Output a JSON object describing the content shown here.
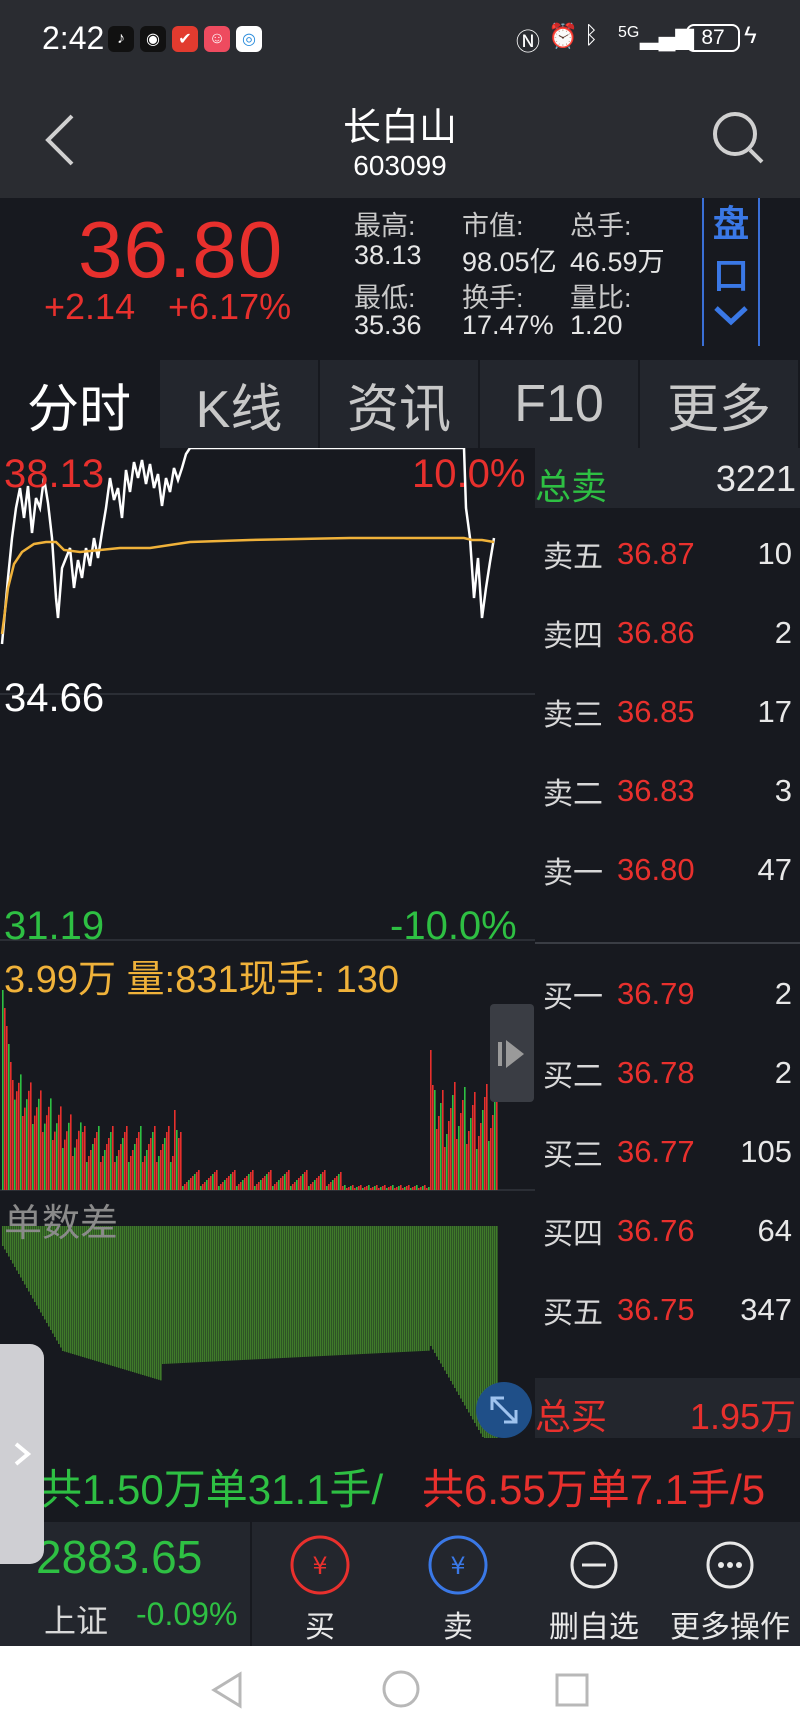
{
  "status_bar": {
    "time": "2:42",
    "battery": "87",
    "network": "5G"
  },
  "header": {
    "title": "长白山",
    "code": "603099"
  },
  "quote": {
    "price": "36.80",
    "change": "+2.14",
    "change_pct": "+6.17%",
    "labels": {
      "high": "最高:",
      "market_cap": "市值:",
      "total_volume": "总手:",
      "low": "最低:",
      "turnover": "换手:",
      "volume_ratio": "量比:"
    },
    "values": {
      "high": "38.13",
      "market_cap": "98.05亿",
      "total_volume": "46.59万",
      "low": "35.36",
      "turnover": "17.47%",
      "volume_ratio": "1.20"
    },
    "pankou_label": [
      "盘",
      "口"
    ]
  },
  "tabs": [
    "分时",
    "K线",
    "资讯",
    "F10",
    "更多"
  ],
  "chart": {
    "price_top": "38.13",
    "pct_top": "10.0%",
    "price_mid": "34.66",
    "price_bottom": "31.19",
    "pct_bottom": "-10.0%",
    "volume_info": "3.99万 量:831现手: 130",
    "indicator_label": "单数差"
  },
  "order_book": {
    "total_sell_label": "总卖",
    "total_sell": "3221",
    "asks": [
      {
        "label": "卖五",
        "price": "36.87",
        "vol": "10"
      },
      {
        "label": "卖四",
        "price": "36.86",
        "vol": "2"
      },
      {
        "label": "卖三",
        "price": "36.85",
        "vol": "17"
      },
      {
        "label": "卖二",
        "price": "36.83",
        "vol": "3"
      },
      {
        "label": "卖一",
        "price": "36.80",
        "vol": "47"
      }
    ],
    "bids": [
      {
        "label": "买一",
        "price": "36.79",
        "vol": "2"
      },
      {
        "label": "买二",
        "price": "36.78",
        "vol": "2"
      },
      {
        "label": "买三",
        "price": "36.77",
        "vol": "105"
      },
      {
        "label": "买四",
        "price": "36.76",
        "vol": "64"
      },
      {
        "label": "买五",
        "price": "36.75",
        "vol": "347"
      }
    ],
    "total_buy_label": "总买",
    "total_buy": "1.95万"
  },
  "ticker": {
    "part1": "共1.50万单31.1手/",
    "part2": "共6.55万单7.1手/5"
  },
  "bottom_bar": {
    "index_value": "2883.65",
    "index_name": "上证",
    "index_change": "-0.09%",
    "buttons": [
      "买",
      "卖",
      "删自选",
      "更多操作"
    ]
  },
  "colors": {
    "up": "#e8302d",
    "down": "#2ec043",
    "avg_line": "#f0b23a",
    "price_line": "#ffffff",
    "accent_blue": "#3a78e6"
  }
}
